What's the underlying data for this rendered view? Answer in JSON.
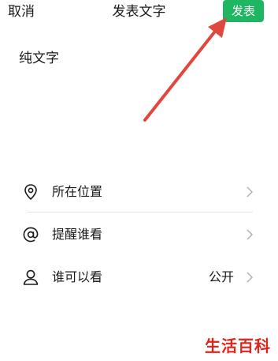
{
  "header": {
    "cancel_label": "取消",
    "title": "发表文字",
    "publish_label": "发表"
  },
  "composer": {
    "text": "纯文字"
  },
  "options": [
    {
      "label": "所在位置",
      "icon": "location-pin-icon",
      "value": ""
    },
    {
      "label": "提醒谁看",
      "icon": "at-sign-icon",
      "value": ""
    },
    {
      "label": "谁可以看",
      "icon": "person-icon",
      "value": "公开"
    }
  ],
  "watermark": {
    "text": "生活百科"
  },
  "colors": {
    "accent_green": "#1fb662",
    "arrow_red": "#e0483f",
    "watermark_red": "#e2231a"
  }
}
